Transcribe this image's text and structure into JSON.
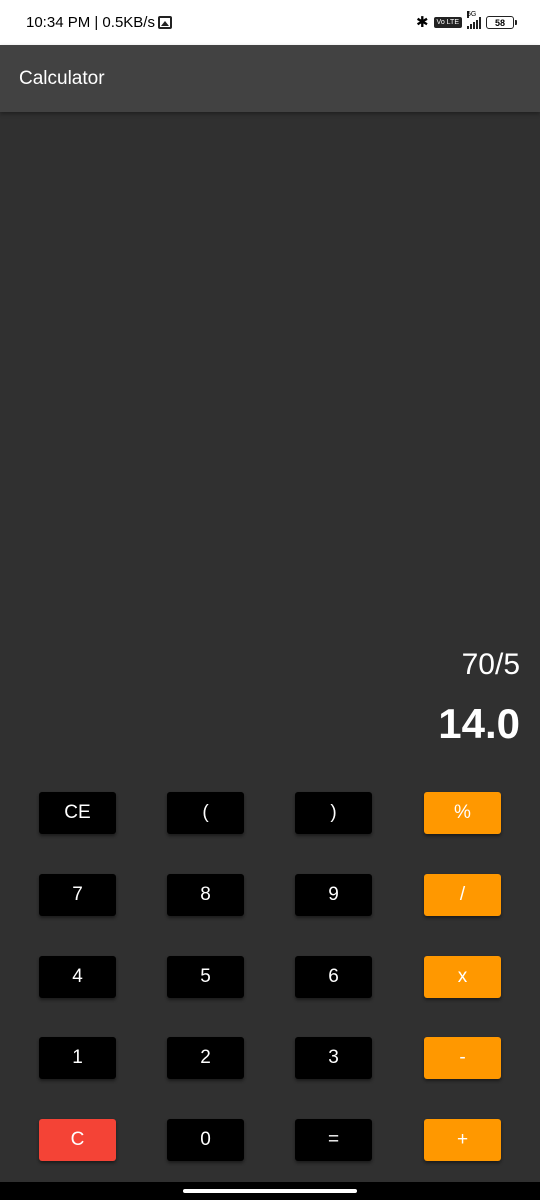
{
  "status_bar": {
    "time_info": "10:34 PM | 0.5KB/s",
    "network": "5G",
    "volte": "Vo LTE",
    "battery": "58"
  },
  "app_bar": {
    "title": "Calculator"
  },
  "display": {
    "expression": "70/5",
    "result": "14.0"
  },
  "keys": {
    "ce": "CE",
    "open_paren": "(",
    "close_paren": ")",
    "percent": "%",
    "seven": "7",
    "eight": "8",
    "nine": "9",
    "divide": "/",
    "four": "4",
    "five": "5",
    "six": "6",
    "multiply": "x",
    "one": "1",
    "two": "2",
    "three": "3",
    "subtract": "-",
    "clear": "C",
    "zero": "0",
    "equals": "=",
    "add": "+"
  },
  "colors": {
    "background": "#303030",
    "app_bar": "#424242",
    "digit_key": "#000000",
    "operator_key": "#ff9800",
    "clear_key": "#f44336"
  }
}
